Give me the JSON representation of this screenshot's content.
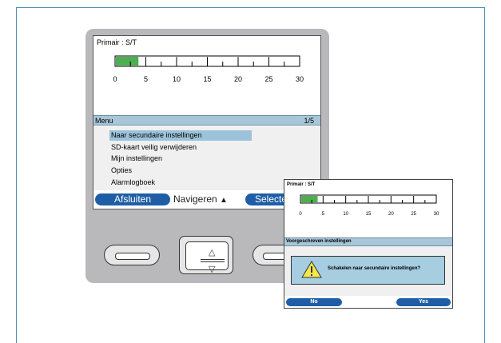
{
  "device": {
    "screen_title": "Primair : S/T",
    "gauge": {
      "min": 0,
      "max": 30,
      "value": 3.8,
      "tick_labels": [
        "0",
        "5",
        "10",
        "15",
        "20",
        "25",
        "30"
      ],
      "fill_color": "#4caf50"
    },
    "menu_header": "Menu",
    "menu_page": "1/5",
    "menu_items": [
      {
        "label": "Naar secundaire instellingen",
        "selected": true
      },
      {
        "label": "SD-kaart veilig verwijderen",
        "selected": false
      },
      {
        "label": "Mijn instellingen",
        "selected": false
      },
      {
        "label": "Opties",
        "selected": false
      },
      {
        "label": "Alarmlogboek",
        "selected": false
      }
    ],
    "softkeys": {
      "left": "Afsluiten",
      "middle": "Navigeren",
      "middle_icon": "up-down-arrow-icon",
      "right": "Selecteren"
    },
    "accent_color": "#1f5ea6"
  },
  "popup": {
    "screen_title": "Primair : S/T",
    "gauge": {
      "min": 0,
      "max": 30,
      "value": 3.8,
      "tick_labels": [
        "0",
        "5",
        "10",
        "15",
        "20",
        "25",
        "30"
      ]
    },
    "header": "Voorgeschreven instellingen",
    "dialog_message": "Schakelen naar secundaire instellingen?",
    "dialog_icon": "warning-icon",
    "softkeys": {
      "left": "No",
      "right": "Yes"
    }
  }
}
